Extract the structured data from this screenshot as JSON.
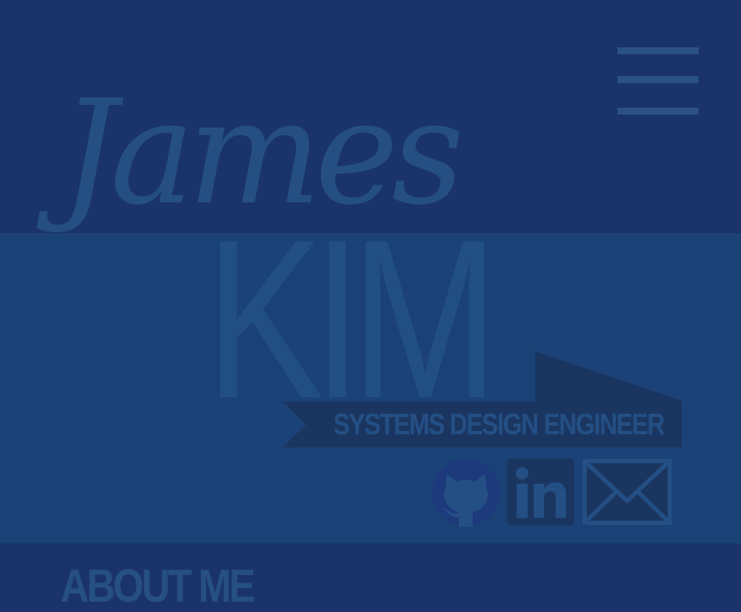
{
  "hero": {
    "first_name": "James",
    "last_name": "KIM",
    "role": "SYSTEMS DESIGN ENGINEER"
  },
  "nav": {
    "menu_icon": "hamburger-menu-icon"
  },
  "social": [
    {
      "name": "GitHub",
      "icon": "github-icon"
    },
    {
      "name": "LinkedIn",
      "icon": "linkedin-icon",
      "glyph": "in"
    },
    {
      "name": "Email",
      "icon": "envelope-icon"
    }
  ],
  "sections": {
    "about_heading": "ABOUT ME"
  },
  "colors": {
    "background": "#1a3469",
    "hero_band": "#1b4277",
    "text_muted": "#244f85",
    "banner": "#1a3660",
    "github_circle": "#1d3a7c"
  }
}
